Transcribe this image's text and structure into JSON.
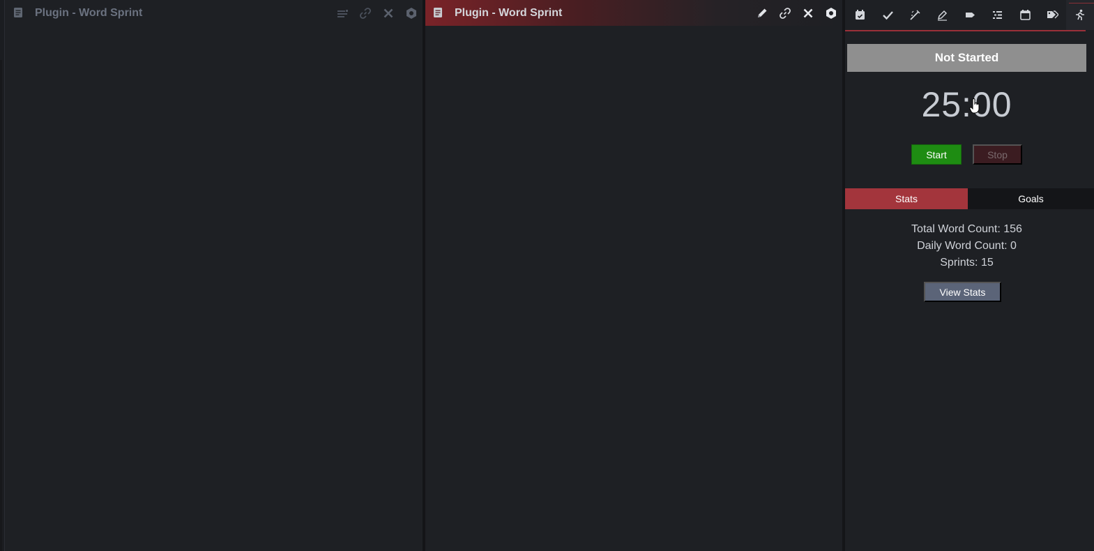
{
  "panes": {
    "left": {
      "title": "Plugin - Word Sprint"
    },
    "middle": {
      "title": "Plugin - Word Sprint"
    }
  },
  "sidebar": {
    "status": "Not Started",
    "timer": "25:00",
    "buttons": {
      "start": "Start",
      "stop": "Stop",
      "view_stats": "View Stats"
    },
    "tabs": {
      "stats": "Stats",
      "goals": "Goals"
    },
    "stats": {
      "total_word_count": "Total Word Count: 156",
      "daily_word_count": "Daily Word Count: 0",
      "sprints": "Sprints: 15"
    }
  },
  "colors": {
    "accent": "#a3353c",
    "start": "#1e8c12",
    "stop": "#3b1c21",
    "status_bg": "#8f8f8f",
    "view_stats_bg": "#5b6478"
  },
  "icons": {
    "left_header": [
      "doc-icon",
      "list-icon",
      "link-icon",
      "close-icon",
      "hexagon-icon"
    ],
    "middle_header": [
      "doc-icon",
      "pencil-icon",
      "link-icon",
      "close-icon",
      "hexagon-icon"
    ],
    "toolbar": [
      "calendar-check-icon",
      "checkmark-icon",
      "wand-icon",
      "pen-icon",
      "tag-icon",
      "outline-icon",
      "calendar-icon",
      "tags-icon",
      "runner-icon"
    ]
  }
}
